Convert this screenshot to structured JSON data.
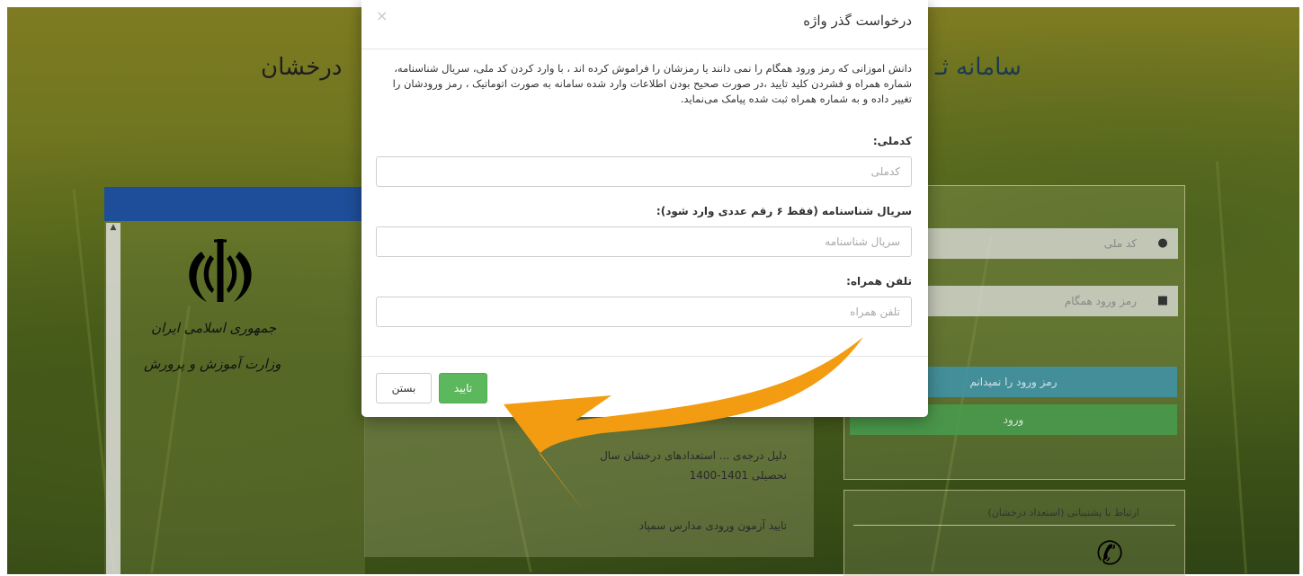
{
  "background": {
    "site_title_left": "درخشان",
    "site_title_right": "سامانه ثـ",
    "emblem_line1": "جمهوری اسلامی ایران",
    "emblem_line2": "وزارت آموزش و پرورش",
    "news": [
      "دلیل درجه‌ی ... استعدادهای درخشان سال",
      "تحصیلی 1401-1400",
      "تایید آزمون ورودی مدارس سمپاد"
    ],
    "login": {
      "national_code_placeholder": "کد ملی",
      "password_placeholder": "رمز ورود همگام",
      "forgot_button": "رمز ورود را نمیدانم",
      "login_button": "ورود"
    },
    "contact_title": "ارتباط با پشتیبانی (استعداد درخشان)"
  },
  "modal": {
    "title": "درخواست گذر واژه",
    "close_symbol": "×",
    "description": "دانش اموزانی که رمز ورود همگام را نمی دانند یا رمزشان را فراموش کرده اند ، با وارد کردن کد ملی، سریال شناسنامه، شماره همراه و فشردن کلید تایید ،در صورت صحیح بودن اطلاعات وارد شده سامانه به صورت اتوماتیک ، رمز ورودشان را تغییر داده و به شماره همراه ثبت شده پیامک می‌نماید.",
    "fields": {
      "national_code_label": "کدملی:",
      "national_code_placeholder": "کدملی",
      "serial_label": "سریال شناسنامه (فقط ۶ رقم عددی وارد شود):",
      "serial_placeholder": "سریال شناسنامه",
      "phone_label": "تلفن همراه:",
      "phone_placeholder": "تلفن همراه"
    },
    "confirm_button": "تایید",
    "close_button": "بستن"
  },
  "colors": {
    "arrow": "#f39c12",
    "confirm_green": "#5cb85c",
    "header_blue": "#1e4e9a"
  }
}
